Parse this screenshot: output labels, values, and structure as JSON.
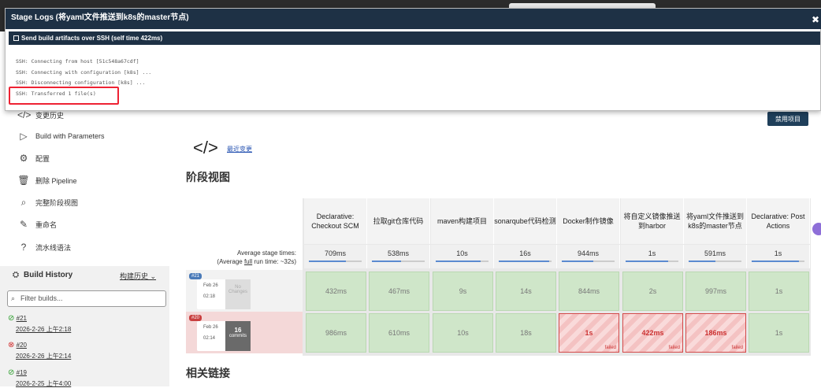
{
  "modal": {
    "title": "Stage Logs (将yaml文件推送到k8s的master节点)",
    "close": "✖",
    "step": "Send build artifacts over SSH (self time 422ms)",
    "log_lines": [
      "SSH: Connecting from host [51c548a67cdf]",
      "SSH: Connecting with configuration [k8s] ...",
      "SSH: Disconnecting configuration [k8s] ...",
      "SSH: Transferred 1 file(s)"
    ]
  },
  "sidebar": {
    "items": [
      {
        "icon": "</>",
        "label": "变更历史"
      },
      {
        "icon": "▷",
        "label": "Build with Parameters"
      },
      {
        "icon": "⚙",
        "label": "配置"
      },
      {
        "icon": "🗑",
        "label": "删除 Pipeline"
      },
      {
        "icon": "⌕",
        "label": "完整阶段视图"
      },
      {
        "icon": "✎",
        "label": "重命名"
      },
      {
        "icon": "?",
        "label": "流水线语法"
      }
    ],
    "build_history": {
      "title": "Build History",
      "link": "构建历史 ⌄",
      "filter_placeholder": "Filter builds...",
      "builds": [
        {
          "num": "#21",
          "date": "2026-2-26 上午2:18",
          "status": "ok"
        },
        {
          "num": "#20",
          "date": "2026-2-26 上午2:14",
          "status": "fail"
        },
        {
          "num": "#19",
          "date": "2026-2-25 上午4:00",
          "status": "ok"
        }
      ]
    }
  },
  "main": {
    "recent_changes": "最近变更",
    "disable_button": "禁用项目",
    "stage_view_title": "阶段视图",
    "related_links_title": "相关链接",
    "avg_stage_label": "Average stage times:",
    "avg_full_label_prefix": "(Average ",
    "avg_full_label_link": "full",
    "avg_full_label_suffix": " run time: ~32s)"
  },
  "stages": [
    {
      "name": "Declarative: Checkout SCM",
      "avg": "709ms",
      "pct": 70
    },
    {
      "name": "拉取git仓库代码",
      "avg": "538ms",
      "pct": 55
    },
    {
      "name": "maven构建项目",
      "avg": "10s",
      "pct": 85
    },
    {
      "name": "sonarqube代码检测",
      "avg": "16s",
      "pct": 95
    },
    {
      "name": "Docker制作镜像",
      "avg": "944ms",
      "pct": 60
    },
    {
      "name": "将自定义镜像推送到harbor",
      "avg": "1s",
      "pct": 80
    },
    {
      "name": "将yaml文件推送到k8s的master节点",
      "avg": "591ms",
      "pct": 50
    },
    {
      "name": "Declarative: Post Actions",
      "avg": "1s",
      "pct": 90
    }
  ],
  "runs": [
    {
      "badge": "#21",
      "date": "Feb 26",
      "time": "02:18",
      "changes": "No Changes",
      "changes_count": "",
      "cells": [
        "432ms",
        "467ms",
        "9s",
        "14s",
        "844ms",
        "2s",
        "997ms",
        "1s"
      ],
      "failed": [
        false,
        false,
        false,
        false,
        false,
        false,
        false,
        false
      ]
    },
    {
      "badge": "#20",
      "date": "Feb 26",
      "time": "02:14",
      "changes": "commits",
      "changes_count": "16",
      "cells": [
        "986ms",
        "610ms",
        "10s",
        "18s",
        "1s",
        "422ms",
        "186ms",
        "1s"
      ],
      "failed": [
        false,
        false,
        false,
        false,
        true,
        true,
        true,
        false
      ]
    }
  ],
  "failed_flag": "failed",
  "colors": {
    "header": "#1e3145",
    "success_cell": "#cfe6c9",
    "failed_border": "#d34a4a",
    "highlight_box": "#e22233"
  }
}
